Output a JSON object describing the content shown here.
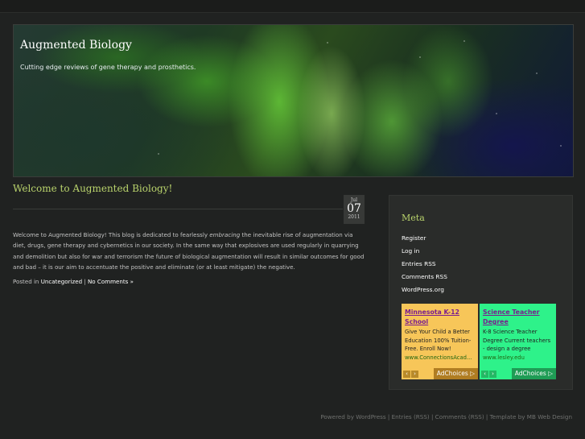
{
  "site": {
    "title": "Augmented Biology",
    "description": "Cutting edge reviews of gene therapy and prosthetics."
  },
  "post": {
    "title": "Welcome to Augmented Biology!",
    "date": {
      "month": "Jul",
      "day": "07",
      "year": "2011"
    },
    "body_before": "Welcome to Augmented Biology! This blog is dedicated to fearlessly ",
    "body_emphasis": "embracing",
    "body_after": " the inevitable rise of augmentation via diet, drugs, gene therapy and cybernetics in our society.  In the same way that explosives are used regularly in quarrying and demolition but also for war and terrorism the future of biological augmentation will result in similar outcomes for good and bad – it is our aim to accentuate the positive and eliminate (or at least mitigate) the negative.",
    "meta": {
      "posted_in": "Posted in ",
      "category": "Uncategorized",
      "separator": " | ",
      "comments": "No Comments »"
    }
  },
  "sidebar": {
    "title": "Meta",
    "links": [
      "Register",
      "Log in",
      "Entries RSS",
      "Comments RSS",
      "WordPress.org"
    ]
  },
  "ads": [
    {
      "title": "Minnesota K-12 School",
      "body": "Give Your Child a Better Education 100% Tuition-Free. Enroll Now!",
      "url": "www.ConnectionsAcad...",
      "choices": "AdChoices ▷"
    },
    {
      "title": "Science Teacher Degree",
      "body": "K-8 Science Teacher Degree Current teachers - design a degree",
      "url": "www.lesley.edu",
      "choices": "AdChoices ▷"
    }
  ],
  "footer": {
    "text": "Powered by WordPress | Entries (RSS) | Comments (RSS) | Template by MB Web Design"
  },
  "colors": {
    "background": "#222423",
    "accent": "#b9d36c",
    "ad1_bg": "#f7c659",
    "ad2_bg": "#2ef28a"
  },
  "icons": [
    "prev-arrow-icon",
    "next-arrow-icon",
    "adchoices-icon"
  ]
}
